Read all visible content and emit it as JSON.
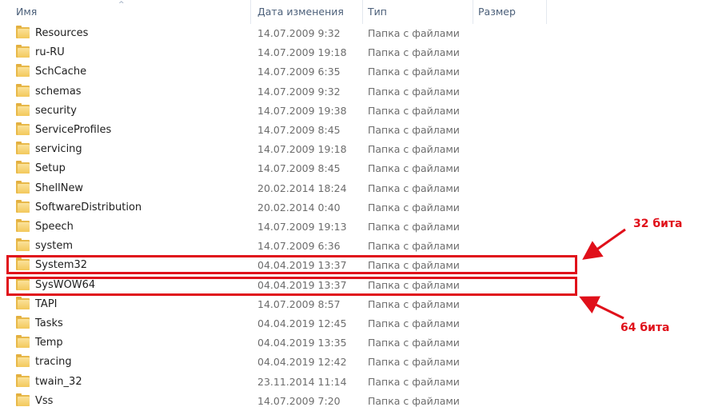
{
  "columns": {
    "name": "Имя",
    "date": "Дата изменения",
    "type": "Тип",
    "size": "Размер"
  },
  "icons": {
    "folder": "folder-icon",
    "sort": "sort-up-arrow-icon"
  },
  "rows": [
    {
      "name": "Resources",
      "date": "14.07.2009 9:32",
      "type": "Папка с файлами"
    },
    {
      "name": "ru-RU",
      "date": "14.07.2009 19:18",
      "type": "Папка с файлами"
    },
    {
      "name": "SchCache",
      "date": "14.07.2009 6:35",
      "type": "Папка с файлами"
    },
    {
      "name": "schemas",
      "date": "14.07.2009 9:32",
      "type": "Папка с файлами"
    },
    {
      "name": "security",
      "date": "14.07.2009 19:38",
      "type": "Папка с файлами"
    },
    {
      "name": "ServiceProfiles",
      "date": "14.07.2009 8:45",
      "type": "Папка с файлами"
    },
    {
      "name": "servicing",
      "date": "14.07.2009 19:18",
      "type": "Папка с файлами"
    },
    {
      "name": "Setup",
      "date": "14.07.2009 8:45",
      "type": "Папка с файлами"
    },
    {
      "name": "ShellNew",
      "date": "20.02.2014 18:24",
      "type": "Папка с файлами"
    },
    {
      "name": "SoftwareDistribution",
      "date": "20.02.2014 0:40",
      "type": "Папка с файлами"
    },
    {
      "name": "Speech",
      "date": "14.07.2009 19:13",
      "type": "Папка с файлами"
    },
    {
      "name": "system",
      "date": "14.07.2009 6:36",
      "type": "Папка с файлами"
    },
    {
      "name": "System32",
      "date": "04.04.2019 13:37",
      "type": "Папка с файлами"
    },
    {
      "name": "SysWOW64",
      "date": "04.04.2019 13:37",
      "type": "Папка с файлами"
    },
    {
      "name": "TAPI",
      "date": "14.07.2009 8:57",
      "type": "Папка с файлами"
    },
    {
      "name": "Tasks",
      "date": "04.04.2019 12:45",
      "type": "Папка с файлами"
    },
    {
      "name": "Temp",
      "date": "04.04.2019 13:35",
      "type": "Папка с файлами"
    },
    {
      "name": "tracing",
      "date": "04.04.2019 12:42",
      "type": "Папка с файлами"
    },
    {
      "name": "twain_32",
      "date": "23.11.2014 11:14",
      "type": "Папка с файлами"
    },
    {
      "name": "Vss",
      "date": "14.07.2009 7:20",
      "type": "Папка с файлами"
    }
  ],
  "annotations": {
    "label_32": "32 бита",
    "label_64": "64 бита",
    "color": "#e0101a"
  }
}
